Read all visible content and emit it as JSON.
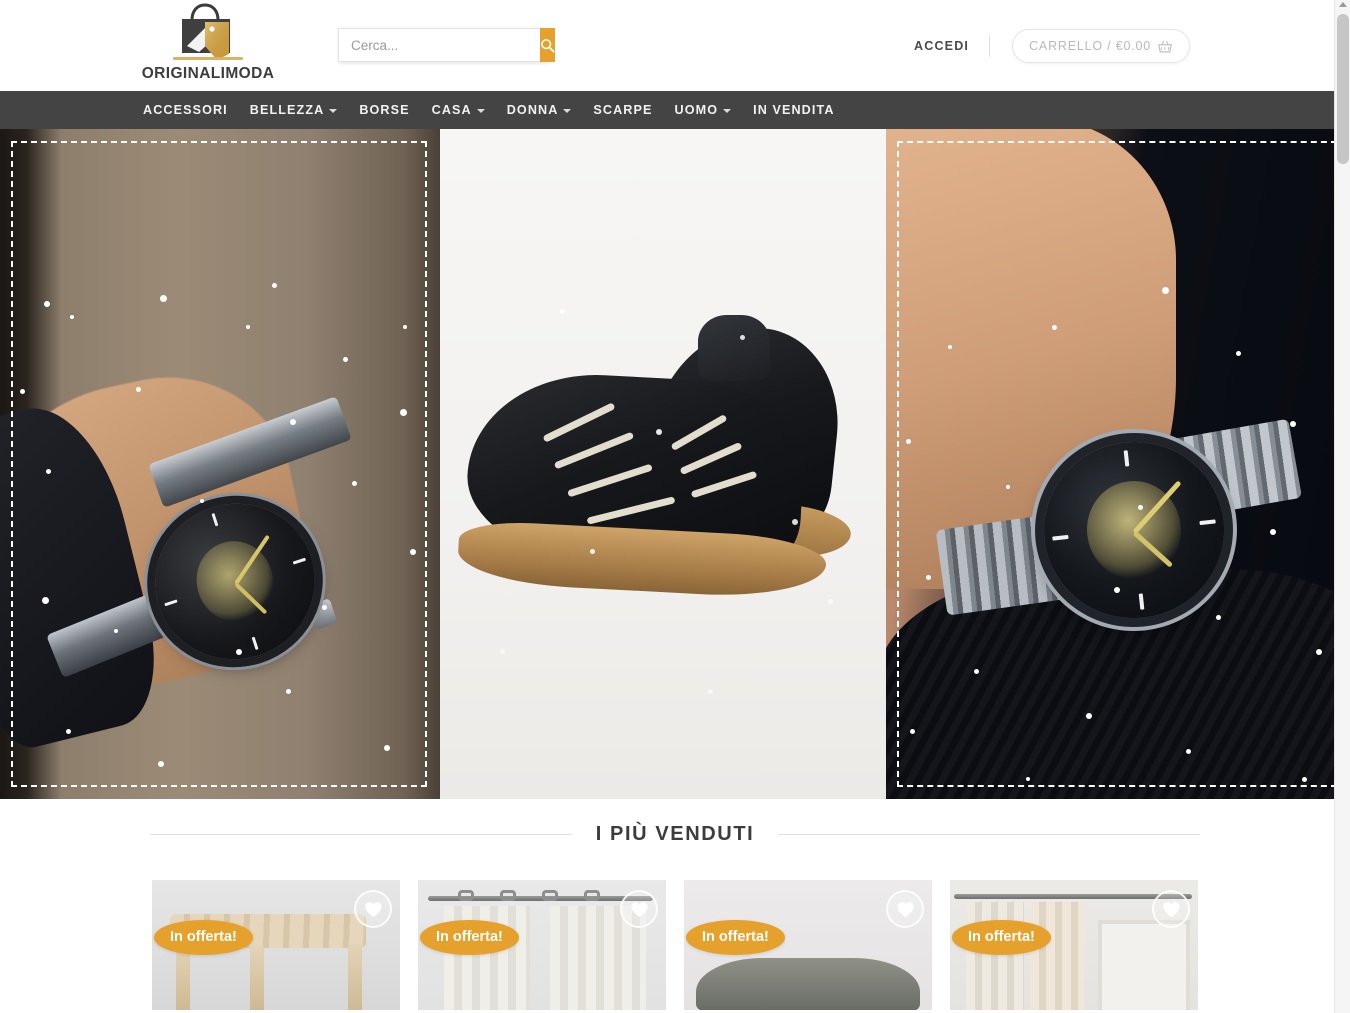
{
  "brand": {
    "name": "ORIGINALIMODA",
    "logo_icon": "shopping-bag-tag-icon",
    "accent_color": "#e5a12b",
    "nav_bg_color": "#444444"
  },
  "search": {
    "placeholder": "Cerca...",
    "value": "",
    "button_icon": "search-icon"
  },
  "account": {
    "login_label": "ACCEDI",
    "cart_label": "CARRELLO / €0.00",
    "cart_icon": "shopping-basket-icon"
  },
  "nav": {
    "items": [
      {
        "label": "ACCESSORI",
        "has_dropdown": false
      },
      {
        "label": "BELLEZZA",
        "has_dropdown": true
      },
      {
        "label": "BORSE",
        "has_dropdown": false
      },
      {
        "label": "CASA",
        "has_dropdown": true
      },
      {
        "label": "DONNA",
        "has_dropdown": true
      },
      {
        "label": "SCARPE",
        "has_dropdown": false
      },
      {
        "label": "UOMO",
        "has_dropdown": true
      },
      {
        "label": "IN VENDITA",
        "has_dropdown": false
      }
    ]
  },
  "hero": {
    "slides": [
      {
        "alt": "orologio-scheletrato-al-polso",
        "selected": true
      },
      {
        "alt": "sneakers-nere-suola-gomma",
        "selected": false
      },
      {
        "alt": "orologio-automatico-bracciale-acciaio",
        "selected": true
      }
    ]
  },
  "bestsellers": {
    "title": "I PIÙ VENDUTI",
    "badge_label": "In offerta!",
    "wishlist_icon": "heart-icon",
    "products": [
      {
        "alt": "sgabello-intrecciato",
        "badge": "In offerta!"
      },
      {
        "alt": "tenda-con-anelli",
        "badge": "In offerta!"
      },
      {
        "alt": "cuscino-grigio",
        "badge": "In offerta!"
      },
      {
        "alt": "tenda-beige-porta",
        "badge": "In offerta!"
      }
    ]
  },
  "scrollbar": {
    "position": "top"
  }
}
